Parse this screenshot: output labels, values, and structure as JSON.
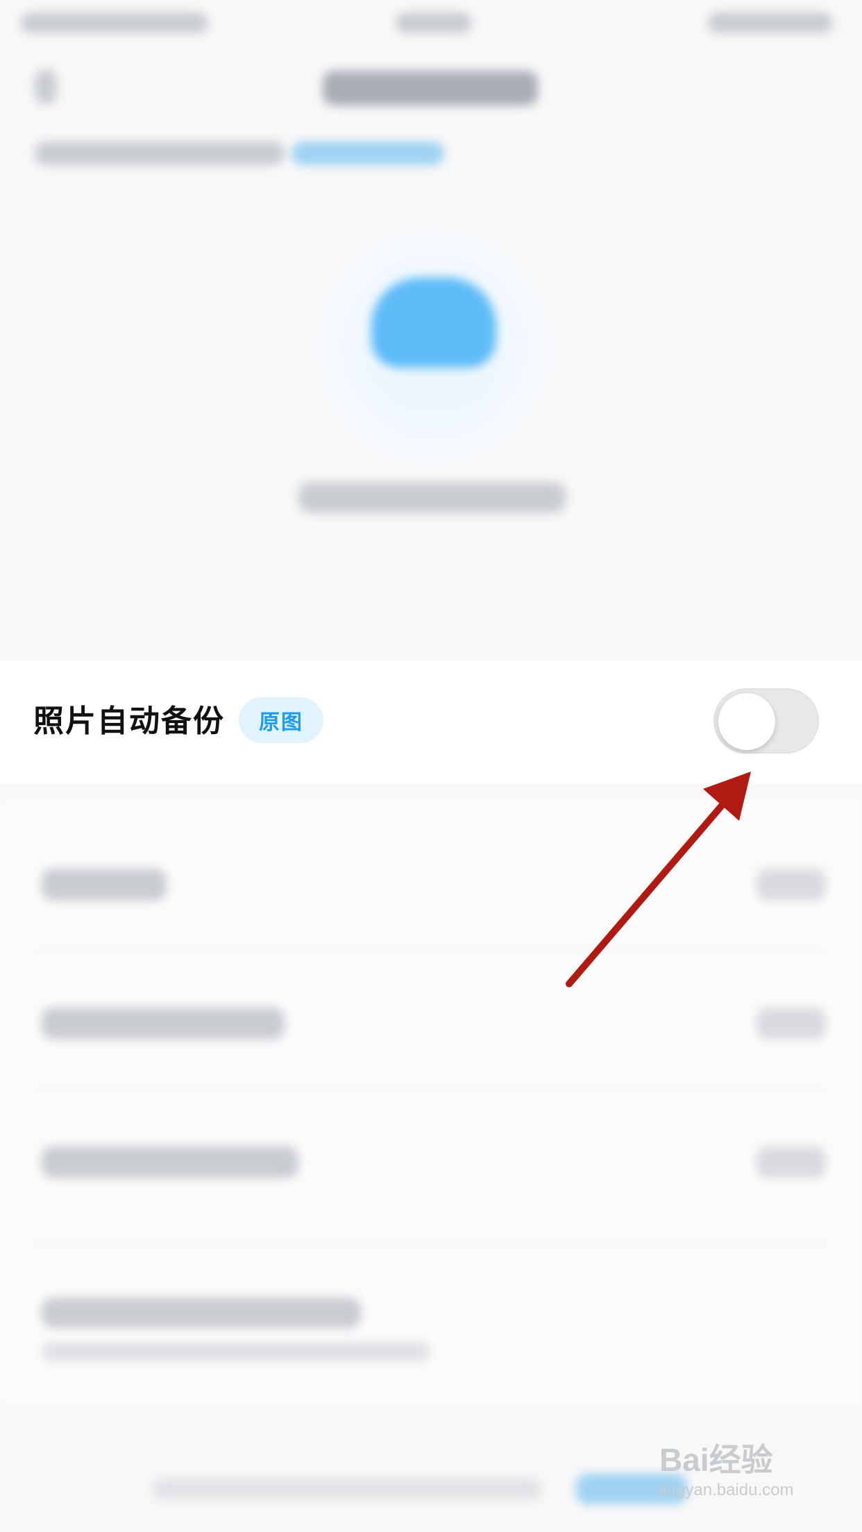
{
  "backup": {
    "title": "照片自动备份",
    "badge": "原图",
    "enabled": false
  },
  "watermark": {
    "brand": "Bai经验",
    "url": "jingyan.baidu.com"
  },
  "colors": {
    "accent": "#1d9de8",
    "badge_bg": "#e2f3fd",
    "toggle_off": "#e7e8ea",
    "arrow": "#b01a12"
  }
}
